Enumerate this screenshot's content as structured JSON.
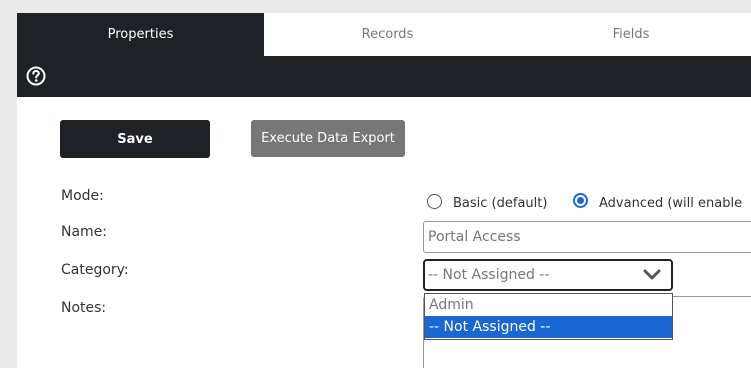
{
  "tabs": [
    {
      "label": "Properties",
      "active": true
    },
    {
      "label": "Records",
      "active": false
    },
    {
      "label": "Fields",
      "active": false
    }
  ],
  "toolbar": {
    "help_icon": "question-circle-icon"
  },
  "actions": {
    "save_label": "Save",
    "export_label": "Execute Data Export"
  },
  "form": {
    "mode": {
      "label": "Mode:",
      "options": [
        {
          "label": "Basic (default)",
          "checked": false
        },
        {
          "label": "Advanced (will enable",
          "checked": true
        }
      ]
    },
    "name": {
      "label": "Name:",
      "value": "Portal Access"
    },
    "category": {
      "label": "Category:",
      "value": "-- Not Assigned --",
      "options": [
        {
          "label": "Admin",
          "selected": false
        },
        {
          "label": "-- Not Assigned --",
          "selected": true
        }
      ]
    },
    "notes": {
      "label": "Notes:",
      "value": ""
    }
  },
  "colors": {
    "dark": "#1e2126",
    "accent": "#1a66d2",
    "secondary_button": "#777777"
  }
}
